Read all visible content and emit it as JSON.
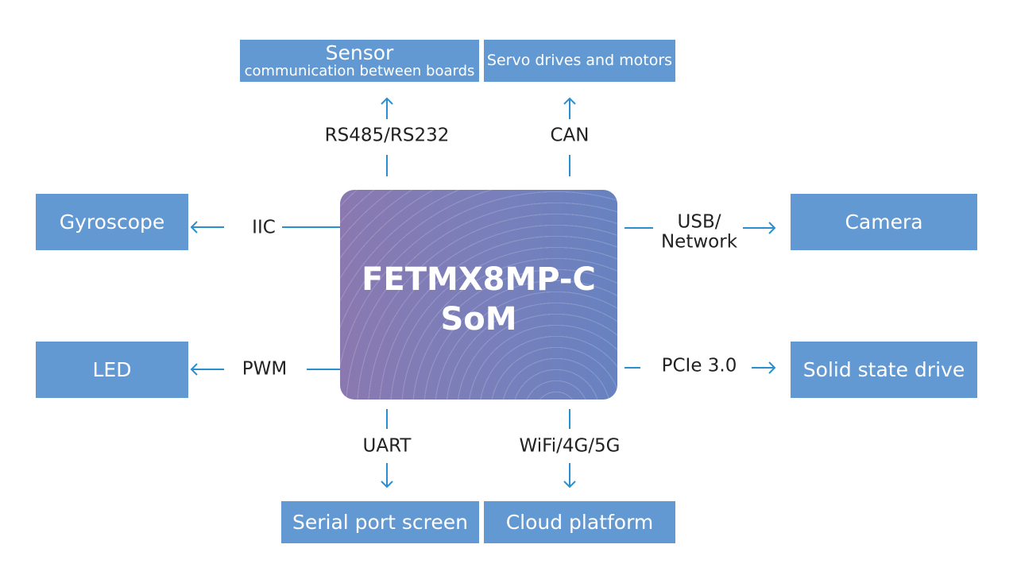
{
  "chip": {
    "line1": "FETMX8MP-C",
    "line2": "SoM"
  },
  "boxes": {
    "sensor_title": "Sensor",
    "sensor_sub": "communication between boards",
    "servo": "Servo drives and motors",
    "gyroscope": "Gyroscope",
    "camera": "Camera",
    "led": "LED",
    "ssd": "Solid state drive",
    "serial": "Serial port screen",
    "cloud": "Cloud platform"
  },
  "interfaces": {
    "rs485": "RS485/RS232",
    "can": "CAN",
    "iic": "IIC",
    "usb_line1": "USB/",
    "usb_line2": "Network",
    "pwm": "PWM",
    "pcie": "PCIe 3.0",
    "uart": "UART",
    "wifi": "WiFi/4G/5G"
  },
  "colors": {
    "box": "#6399d2",
    "connector": "#2a8fd0",
    "chip_left": "#8a78b0",
    "chip_right": "#6782c0"
  }
}
